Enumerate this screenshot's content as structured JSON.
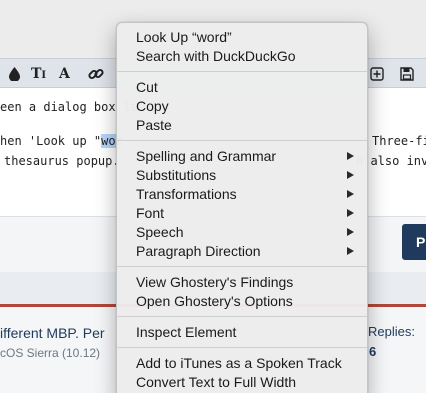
{
  "context_menu": {
    "groups": [
      {
        "items": [
          {
            "label": "Look Up “word”",
            "submenu": false
          },
          {
            "label": "Search with DuckDuckGo",
            "submenu": false
          }
        ]
      },
      {
        "items": [
          {
            "label": "Cut",
            "submenu": false
          },
          {
            "label": "Copy",
            "submenu": false
          },
          {
            "label": "Paste",
            "submenu": false
          }
        ]
      },
      {
        "items": [
          {
            "label": "Spelling and Grammar",
            "submenu": true
          },
          {
            "label": "Substitutions",
            "submenu": true
          },
          {
            "label": "Transformations",
            "submenu": true
          },
          {
            "label": "Font",
            "submenu": true
          },
          {
            "label": "Speech",
            "submenu": true
          },
          {
            "label": "Paragraph Direction",
            "submenu": true
          }
        ]
      },
      {
        "items": [
          {
            "label": "View Ghostery's Findings",
            "submenu": false
          },
          {
            "label": "Open Ghostery's Options",
            "submenu": false
          }
        ]
      },
      {
        "items": [
          {
            "label": "Inspect Element",
            "submenu": false
          }
        ]
      },
      {
        "items": [
          {
            "label": "Add to iTunes as a Spoken Track",
            "submenu": false
          },
          {
            "label": "Convert Text to Full Width",
            "submenu": false
          }
        ]
      }
    ]
  },
  "toolbar": {
    "icons": [
      {
        "name": "ink-drop-icon",
        "glyph": "💧"
      },
      {
        "name": "font-size-icon",
        "glyph": "T⇕"
      },
      {
        "name": "font-icon",
        "glyph": "A"
      },
      {
        "name": "link-icon",
        "glyph": "🔗"
      }
    ],
    "right_icons": [
      {
        "name": "insert-box-icon",
        "glyph": "⊞"
      },
      {
        "name": "save-icon",
        "glyph": "💾"
      }
    ]
  },
  "editor": {
    "line1": "een a dialog box li",
    "line2_before": "hen 'Look up \"",
    "line2_selected": "wor",
    "line2_right": "Three-fi",
    "line3_left": "thesaurus popup.",
    "line3_right": "n also inv"
  },
  "post_button": {
    "label": "P"
  },
  "thread": {
    "title": "ifferent MBP. Per",
    "subtitle": "cOS Sierra (10.12)",
    "replies_label": "Replies:",
    "replies_count": "6"
  }
}
